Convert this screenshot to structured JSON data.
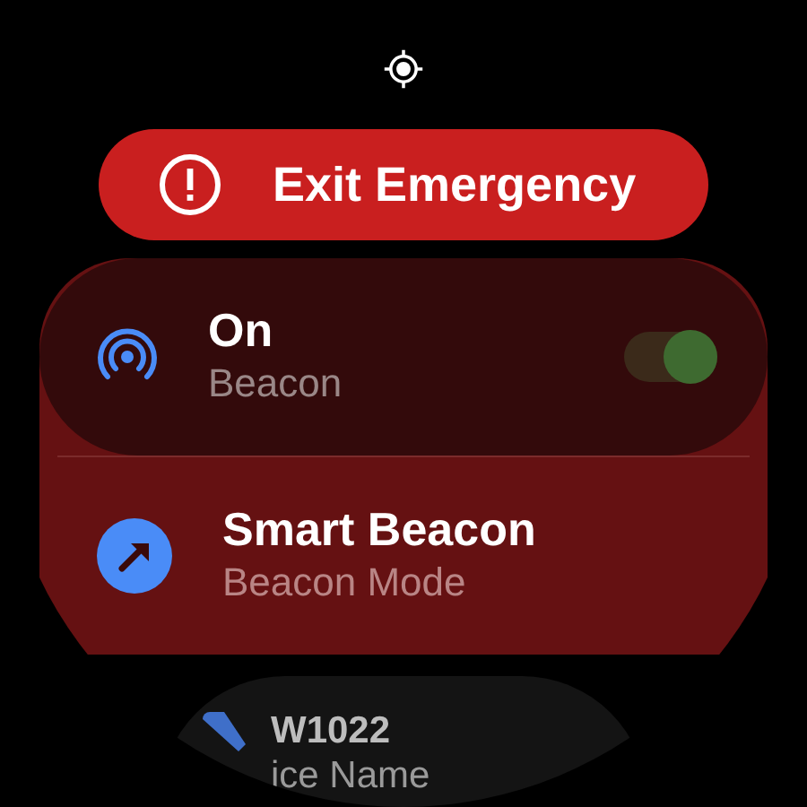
{
  "exit_button": {
    "label": "Exit Emergency"
  },
  "items": [
    {
      "kind": "toggle",
      "title": "On",
      "subtitle": "Beacon",
      "on": true
    },
    {
      "kind": "link",
      "title": "Smart Beacon",
      "subtitle": "Beacon Mode"
    }
  ],
  "device_card": {
    "title": "W1022",
    "subtitle": "ice Name"
  }
}
